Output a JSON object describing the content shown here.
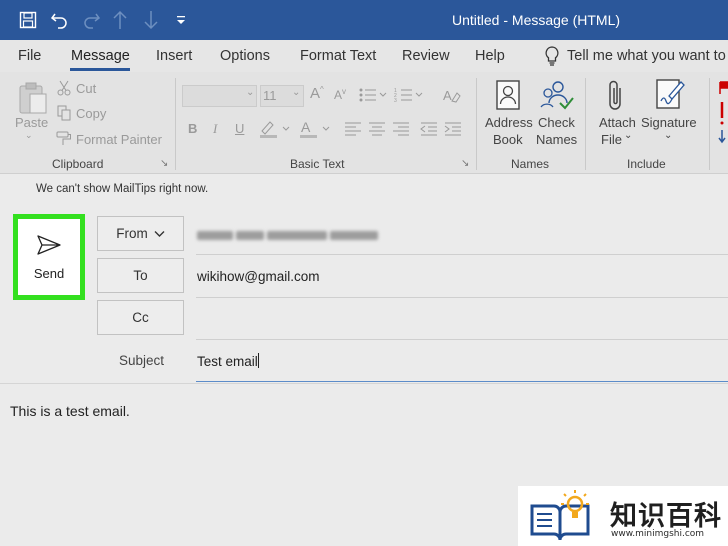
{
  "window": {
    "title": "Untitled  -  Message (HTML)"
  },
  "qat": {
    "icons": [
      "save-icon",
      "undo-icon",
      "redo-icon",
      "up-arrow-icon",
      "down-arrow-icon",
      "customize-qat-icon"
    ]
  },
  "tabs": [
    {
      "label": "File"
    },
    {
      "label": "Message"
    },
    {
      "label": "Insert"
    },
    {
      "label": "Options"
    },
    {
      "label": "Format Text"
    },
    {
      "label": "Review"
    },
    {
      "label": "Help"
    }
  ],
  "tell_me": {
    "placeholder": "Tell me what you want to"
  },
  "ribbon": {
    "clipboard": {
      "paste_label": "Paste",
      "cut_label": "Cut",
      "copy_label": "Copy",
      "format_painter_label": "Format Painter",
      "group_label": "Clipboard"
    },
    "basic_text": {
      "font_size": "11",
      "bold": "B",
      "italic": "I",
      "underline": "U",
      "group_label": "Basic Text"
    },
    "names": {
      "address_book_line1": "Address",
      "address_book_line2": "Book",
      "check_names_line1": "Check",
      "check_names_line2": "Names",
      "group_label": "Names"
    },
    "include": {
      "attach_file_line1": "Attach",
      "attach_file_line2": "File",
      "signature_label": "Signature",
      "group_label": "Include"
    }
  },
  "mailtips": "We can't show MailTips right now.",
  "send_label": "Send",
  "fields": {
    "from_label": "From",
    "to_label": "To",
    "to_value": "wikihow@gmail.com",
    "cc_label": "Cc",
    "cc_value": "",
    "subject_label": "Subject",
    "subject_value": "Test email"
  },
  "body_text": "This is a test email.",
  "watermark": {
    "name": "知识百科",
    "url": "www.minimgshi.com"
  },
  "colors": {
    "titlebar": "#2b579a",
    "send_highlight": "#33e01f"
  }
}
